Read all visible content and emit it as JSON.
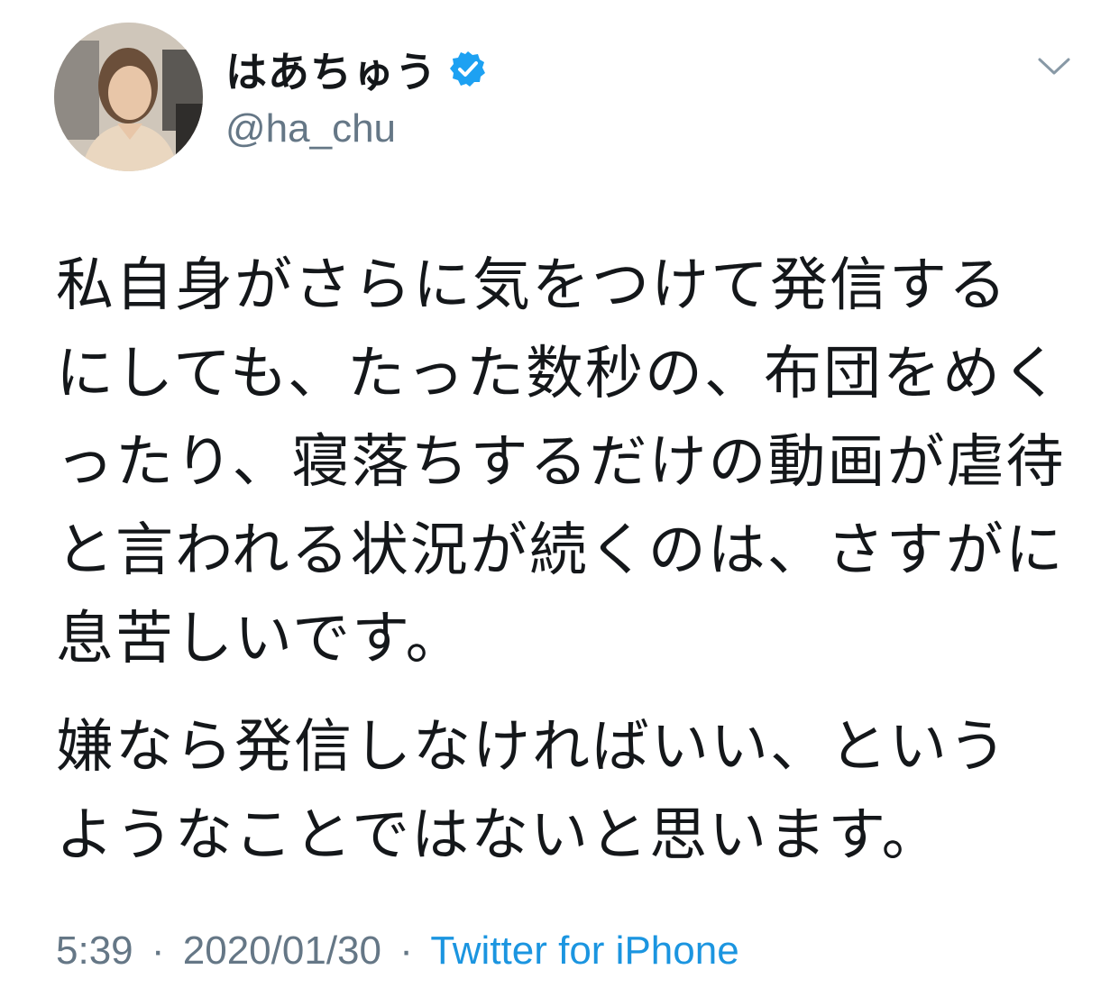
{
  "tweet": {
    "author": {
      "display_name": "はあちゅう",
      "handle": "@ha_chu",
      "verified_icon": "verified-badge-icon",
      "verified_color": "#1da1f2"
    },
    "menu_icon": "chevron-down-icon",
    "text": {
      "paragraph_1": "私自身がさらに気をつけて発信するにしても、たった数秒の、布団をめくったり、寝落ちするだけの動画が虐待と言われる状況が続くのは、さすがに息苦しいです。",
      "paragraph_2": "嫌なら発信しなければいい、というようなことではないと思います。"
    },
    "meta": {
      "time": "5:39",
      "separator": "·",
      "date": "2020/01/30",
      "source": "Twitter for iPhone",
      "source_color": "#1b95e0"
    }
  }
}
